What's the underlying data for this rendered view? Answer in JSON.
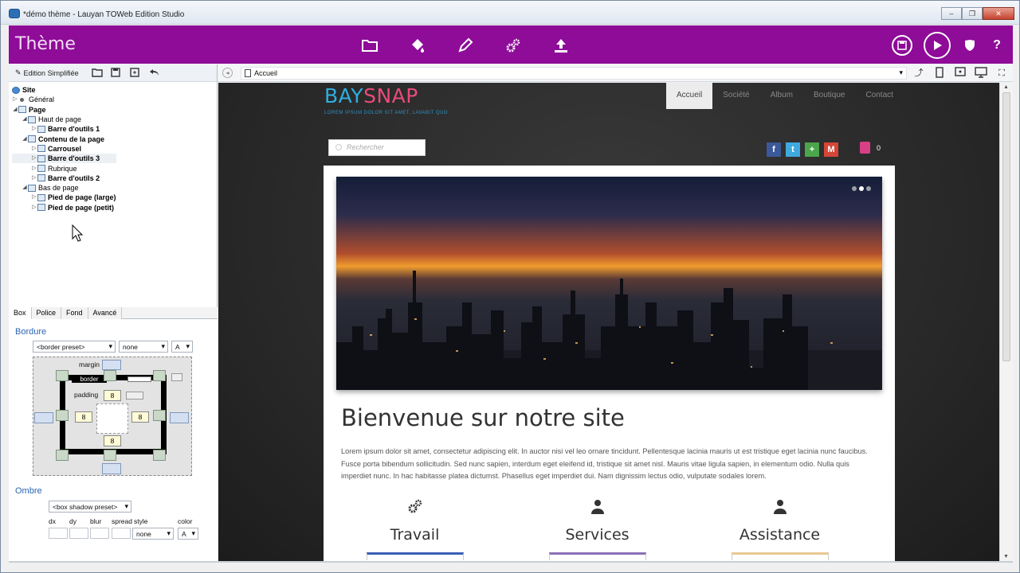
{
  "window": {
    "title": "*démo thème - Lauyan TOWeb Edition Studio",
    "buttons": [
      "–",
      "❐",
      "✕"
    ]
  },
  "topbar": {
    "title": "Thème",
    "icons": [
      "folder-icon",
      "paint-bucket-icon",
      "pencil-icon",
      "gears-icon",
      "upload-icon"
    ],
    "right_icons": [
      "save-icon",
      "play-icon",
      "shield-icon",
      "help-icon"
    ],
    "help_label": "?",
    "accent_color": "#8e0c98"
  },
  "leftpanel": {
    "mode_label": "Edition Simplifiée",
    "tree": [
      {
        "label": "Site",
        "bold": true,
        "level": 0
      },
      {
        "label": "Général",
        "bold": false,
        "level": 1
      },
      {
        "label": "Page",
        "bold": true,
        "level": 1
      },
      {
        "label": "Haut de page",
        "bold": false,
        "level": 2
      },
      {
        "label": "Barre d'outils 1",
        "bold": true,
        "level": 3
      },
      {
        "label": "Contenu de la page",
        "bold": true,
        "level": 2
      },
      {
        "label": "Carrousel",
        "bold": true,
        "level": 3
      },
      {
        "label": "Barre d'outils 3",
        "bold": true,
        "level": 3
      },
      {
        "label": "Rubrique",
        "bold": false,
        "level": 3
      },
      {
        "label": "Barre d'outils 2",
        "bold": true,
        "level": 3
      },
      {
        "label": "Bas de page",
        "bold": false,
        "level": 2
      },
      {
        "label": "Pied de page (large)",
        "bold": true,
        "level": 3
      },
      {
        "label": "Pied de page (petit)",
        "bold": true,
        "level": 3
      }
    ],
    "tabs": [
      "Box",
      "Police",
      "Fond",
      "Avancé"
    ],
    "bordure": {
      "label": "Bordure",
      "preset": "<border preset>",
      "style": "none",
      "color": "A",
      "margin_label": "margin",
      "border_label": "border",
      "padding_label": "padding",
      "padding_top": "8",
      "padding_left": "8",
      "padding_right": "8",
      "padding_bottom": "8"
    },
    "ombre": {
      "label": "Ombre",
      "preset": "<box shadow preset>",
      "cols": [
        "dx",
        "dy",
        "blur",
        "spread",
        "style",
        "color"
      ],
      "style": "none",
      "color": "A"
    }
  },
  "addressbar": {
    "page": "Accueil"
  },
  "site": {
    "logo_part1": "BAY",
    "logo_part2": "SNAP",
    "tagline": "LOREM IPSUM DOLOR SIT AMET, LAVABIT QUO",
    "nav": [
      "Accueil",
      "Société",
      "Album",
      "Boutique",
      "Contact"
    ],
    "search_placeholder": "Rechercher",
    "social": [
      "f",
      "t",
      "+",
      "M"
    ],
    "cart_count": "0",
    "welcome": "Bienvenue sur notre site",
    "lorem": "Lorem ipsum dolor sit amet, consectetur adipiscing elit. In auctor nisi vel leo ornare tincidunt. Pellentesque lacinia mauris ut est tristique eget lacinia nunc faucibus. Fusce porta bibendum sollicitudin. Sed nunc sapien, interdum eget eleifend id, tristique sit amet nisl. Mauris vitae ligula sapien, in elementum odio. Nulla quis imperdiet nunc. In hac habitasse platea dictumst. Phasellus eget imperdiet dui. Nam dignissim lectus odio, vulputate sodales lorem.",
    "features": [
      {
        "title": "Travail",
        "icon": "gears-icon"
      },
      {
        "title": "Services",
        "icon": "user-icon"
      },
      {
        "title": "Assistance",
        "icon": "user-icon"
      }
    ]
  }
}
